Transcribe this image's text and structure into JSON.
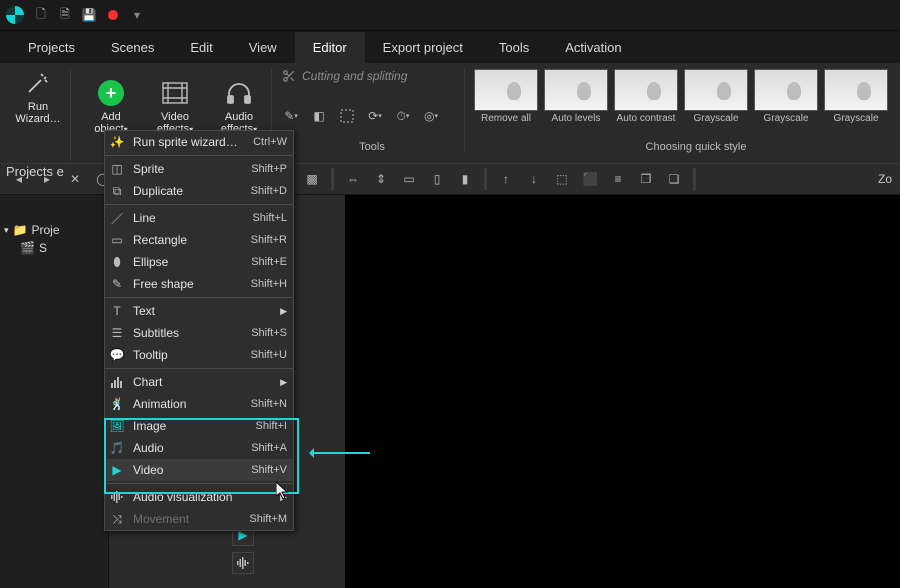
{
  "titlebar": {
    "icons": [
      "logo",
      "new-file",
      "open-file",
      "save-file",
      "record",
      "dropdown"
    ]
  },
  "menubar": {
    "items": [
      "Projects",
      "Scenes",
      "Edit",
      "View",
      "Editor",
      "Export project",
      "Tools",
      "Activation"
    ],
    "active_index": 4
  },
  "ribbon": {
    "run_wizard_label": "Run\nWizard…",
    "add_object_label": "Add\nobject",
    "video_effects_label": "Video\neffects",
    "audio_effects_label": "Audio\neffects",
    "cutting_label": "Cutting and splitting",
    "tools_group_label": "Tools",
    "quick_style_label": "Choosing quick style",
    "thumbs": [
      {
        "label": "Remove all"
      },
      {
        "label": "Auto levels"
      },
      {
        "label": "Auto contrast"
      },
      {
        "label": "Grayscale"
      },
      {
        "label": "Grayscale"
      },
      {
        "label": "Grayscale"
      }
    ]
  },
  "projects_panel_label": "Projects e",
  "tree": {
    "root": "Proje",
    "child": "S"
  },
  "toolbar2_right": "Zo",
  "dropdown": {
    "items": [
      {
        "icon": "wand",
        "label": "Run sprite wizard…",
        "shortcut": "Ctrl+W"
      },
      {
        "sep": true
      },
      {
        "icon": "sprite",
        "label": "Sprite",
        "shortcut": "Shift+P"
      },
      {
        "icon": "duplicate",
        "label": "Duplicate",
        "shortcut": "Shift+D"
      },
      {
        "sep": true
      },
      {
        "icon": "line",
        "label": "Line",
        "shortcut": "Shift+L"
      },
      {
        "icon": "rectangle",
        "label": "Rectangle",
        "shortcut": "Shift+R"
      },
      {
        "icon": "ellipse",
        "label": "Ellipse",
        "shortcut": "Shift+E"
      },
      {
        "icon": "freeshape",
        "label": "Free shape",
        "shortcut": "Shift+H"
      },
      {
        "sep": true
      },
      {
        "icon": "text",
        "label": "Text",
        "submenu": true
      },
      {
        "icon": "subtitles",
        "label": "Subtitles",
        "shortcut": "Shift+S"
      },
      {
        "icon": "tooltip",
        "label": "Tooltip",
        "shortcut": "Shift+U"
      },
      {
        "sep": true
      },
      {
        "icon": "chart",
        "label": "Chart",
        "submenu": true
      },
      {
        "icon": "animation",
        "label": "Animation",
        "shortcut": "Shift+N"
      },
      {
        "icon": "image",
        "label": "Image",
        "shortcut": "Shift+I"
      },
      {
        "icon": "audio",
        "label": "Audio",
        "shortcut": "Shift+A"
      },
      {
        "icon": "video",
        "label": "Video",
        "shortcut": "Shift+V"
      },
      {
        "sep": true
      },
      {
        "icon": "audioviz",
        "label": "Audio visualization",
        "submenu": true
      },
      {
        "icon": "movement",
        "label": "Movement",
        "shortcut": "Shift+M",
        "disabled": true
      }
    ]
  }
}
